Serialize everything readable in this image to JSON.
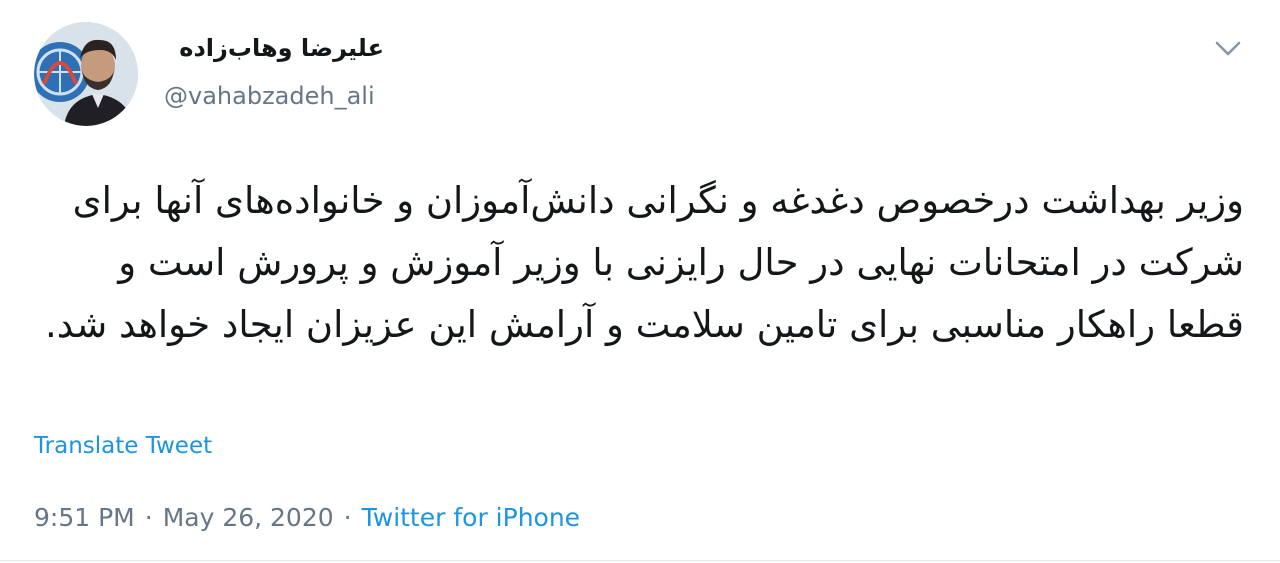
{
  "author": {
    "display_name": "علیرضا وهاب‌زاده",
    "handle": "@vahabzadeh_ali",
    "avatar_icon": "profile-photo"
  },
  "menu": {
    "icon": "chevron-down-icon"
  },
  "tweet": {
    "text": "وزیر بهداشت درخصوص دغدغه و نگرانی دانش‌آموزان و خانواده‌های آنها برای شرکت در امتحانات نهایی در حال رایزنی با وزیر آموزش و پرورش است و قطعا راهکار مناسبی برای تامین سلامت و آرامش این عزیزان ایجاد خواهد شد.",
    "translate_label": "Translate Tweet"
  },
  "meta": {
    "time": "9:51 PM",
    "separator_1": "·",
    "date": "May 26, 2020",
    "separator_2": "·",
    "source": "Twitter for iPhone"
  },
  "colors": {
    "link": "#1b95e0",
    "secondary_text": "#657786",
    "primary_text": "#14171a"
  }
}
